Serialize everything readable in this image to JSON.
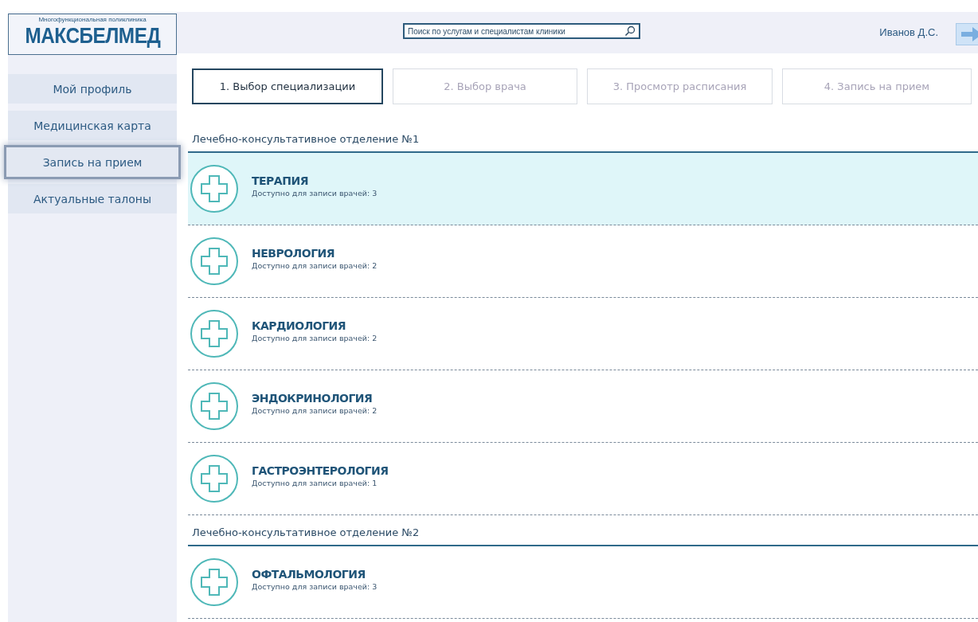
{
  "logo": {
    "tagline": "Многофункциональная поликлиника",
    "name": "МАКСБЕЛМЕД"
  },
  "search": {
    "placeholder": "Поиск по услугам и специалистам клиники"
  },
  "user": {
    "name": "Иванов Д.С."
  },
  "sidebar": {
    "items": [
      {
        "label": "Мой профиль",
        "selected": false
      },
      {
        "label": "Медицинская карта",
        "selected": false
      },
      {
        "label": "Запись на прием",
        "selected": true
      },
      {
        "label": "Актуальные талоны",
        "selected": false
      }
    ]
  },
  "steps": [
    {
      "label": "1. Выбор специализации",
      "selected": true
    },
    {
      "label": "2. Выбор врача",
      "selected": false
    },
    {
      "label": "3. Просмотр расписания",
      "selected": false
    },
    {
      "label": "4. Запись на прием",
      "selected": false
    }
  ],
  "departments": [
    {
      "title": "Лечебно-консультативное отделение №1",
      "specialties": [
        {
          "name": "ТЕРАПИЯ",
          "availability": "Доступно для записи врачей: 3",
          "selected": true
        },
        {
          "name": "НЕВРОЛОГИЯ",
          "availability": "Доступно для записи врачей: 2",
          "selected": false
        },
        {
          "name": "КАРДИОЛОГИЯ",
          "availability": "Доступно для записи врачей: 2",
          "selected": false
        },
        {
          "name": "ЭНДОКРИНОЛОГИЯ",
          "availability": "Доступно для записи врачей: 2",
          "selected": false
        },
        {
          "name": "ГАСТРОЭНТЕРОЛОГИЯ",
          "availability": "Доступно для записи врачей: 1",
          "selected": false
        }
      ]
    },
    {
      "title": "Лечебно-консультативное отделение №2",
      "specialties": [
        {
          "name": "ОФТАЛЬМОЛОГИЯ",
          "availability": "Доступно для записи врачей: 3",
          "selected": false
        }
      ]
    }
  ]
}
